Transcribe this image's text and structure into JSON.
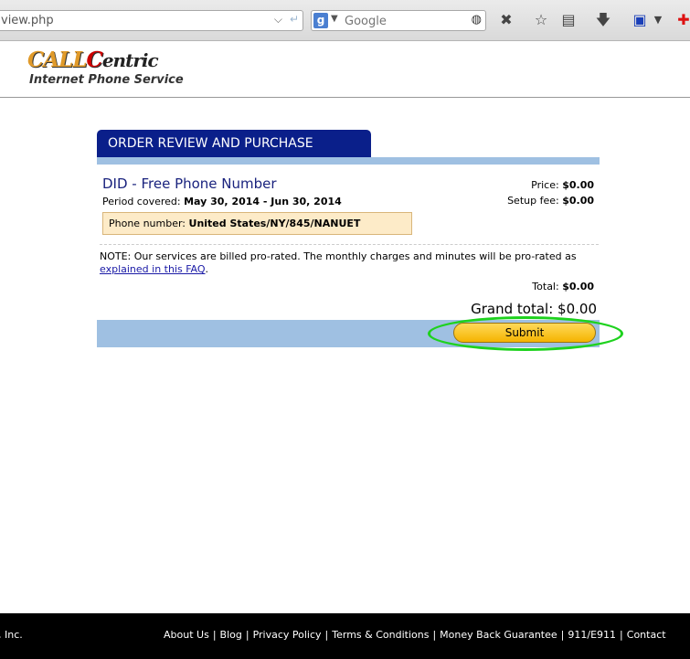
{
  "browser": {
    "url_fragment": "view.php",
    "search_placeholder": "Google",
    "search_engine_letter": "g"
  },
  "header": {
    "logo_part1": "CALL",
    "logo_part2": "C",
    "logo_part3": "entric",
    "tagline": "Internet Phone Service"
  },
  "order": {
    "tab_title": "ORDER REVIEW AND PURCHASE",
    "item_title": "DID - Free Phone Number",
    "period_label": "Period covered:",
    "period_value": "May 30, 2014 - Jun 30, 2014",
    "phone_label": "Phone number:",
    "phone_value": "United States/NY/845/NANUET",
    "price_label": "Price:",
    "price_value": "$0.00",
    "setup_label": "Setup fee:",
    "setup_value": "$0.00",
    "note_text": "NOTE: Our services are billed pro-rated. The monthly charges and minutes will be pro-rated as",
    "note_link": "explained in this FAQ",
    "note_end": ".",
    "total_label": "Total:",
    "total_value": "$0.00",
    "grand_label": "Grand total:",
    "grand_value": "$0.00",
    "submit_label": "Submit"
  },
  "footer": {
    "copyright": ", Inc.",
    "links": [
      "About Us",
      "Blog",
      "Privacy Policy",
      "Terms & Conditions",
      "Money Back Guarantee",
      "911/E911",
      "Contact"
    ]
  },
  "colors": {
    "tab_bg": "#0a1f8a",
    "strip_bg": "#9fc0e2",
    "submit_bg": "#f5b400",
    "highlight": "#1ed21e"
  }
}
